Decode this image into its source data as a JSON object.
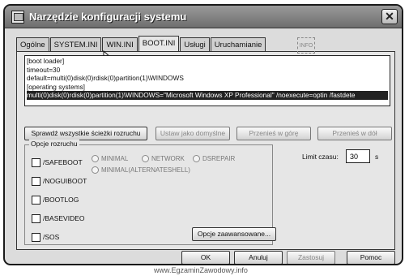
{
  "window": {
    "title": "Narzędzie konfiguracji systemu",
    "close_glyph": "✕"
  },
  "tabs": [
    {
      "label": "Ogólne",
      "active": false
    },
    {
      "label": "SYSTEM.INI",
      "active": false
    },
    {
      "label": "WIN.INI",
      "active": false
    },
    {
      "label": "BOOT.INI",
      "active": true
    },
    {
      "label": "Usługi",
      "active": false
    },
    {
      "label": "Uruchamianie",
      "active": false
    }
  ],
  "info_box": "INFO",
  "bootini": {
    "lines": [
      "[boot loader]",
      "timeout=30",
      "default=multi(0)disk(0)rdisk(0)partition(1)\\WINDOWS",
      "[operating systems]",
      "multi(0)disk(0)rdisk(0)partition(1)\\WINDOWS=\"Microsoft Windows XP Professional\" /noexecute=optin /fastdete"
    ],
    "selected_line_index": 4
  },
  "buttons": {
    "check_paths": "Sprawdź wszystkie ścieżki rozruchu",
    "set_default": "Ustaw jako domyślne",
    "move_up": "Przenieś w górę",
    "move_down": "Przenieś w dół",
    "advanced": "Opcje zaawansowane...",
    "ok": "OK",
    "cancel": "Anuluj",
    "apply": "Zastosuj",
    "help": "Pomoc"
  },
  "boot_options": {
    "title": "Opcje rozruchu",
    "checkboxes": [
      {
        "label": "/SAFEBOOT",
        "checked": false
      },
      {
        "label": "/NOGUIBOOT",
        "checked": false
      },
      {
        "label": "/BOOTLOG",
        "checked": false
      },
      {
        "label": "/BASEVIDEO",
        "checked": false
      },
      {
        "label": "/SOS",
        "checked": false
      }
    ],
    "radios": [
      {
        "label": "MINIMAL"
      },
      {
        "label": "NETWORK"
      },
      {
        "label": "DSREPAIR"
      },
      {
        "label": "MINIMAL(ALTERNATESHELL)"
      }
    ]
  },
  "timeout": {
    "label": "Limit czasu:",
    "value": "30",
    "unit": "s"
  },
  "watermark": "www.EgzaminZawodowy.info"
}
